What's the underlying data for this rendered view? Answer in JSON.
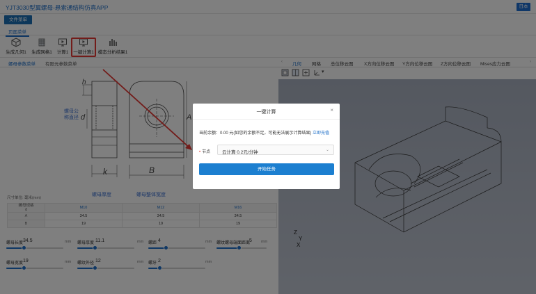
{
  "app": {
    "title": "YJT3030型翼螺母-悬索通结构仿真APP",
    "lang_button": "日本"
  },
  "menu": {
    "file": "文件菜单",
    "page": "页面菜单"
  },
  "toolbar": [
    {
      "label": "生成几何1",
      "icon": "cube-icon"
    },
    {
      "label": "生成网格1",
      "icon": "mesh-icon"
    },
    {
      "label": "计算1",
      "icon": "monitor-icon"
    },
    {
      "label": "一键计算1",
      "icon": "play-monitor-icon"
    },
    {
      "label": "模态分析结果1",
      "icon": "bar-chart-icon"
    }
  ],
  "left_tabs": [
    "螺母参数菜单",
    "有限元参数菜单"
  ],
  "drawing": {
    "labels": {
      "nut_diameter": "螺母公\n称直径",
      "nut_thickness": "螺母厚度",
      "nut_width": "螺母整体宽度",
      "k": "k",
      "B": "B",
      "d": "d",
      "A": "A",
      "h": "h"
    }
  },
  "dims_table": {
    "unit_note": "尺寸单位: 毫米(mm)",
    "corner": "螺母规格\nd",
    "columns": [
      "M10",
      "M12",
      "M16"
    ],
    "rows": [
      {
        "name": "A",
        "values": [
          "34.5",
          "34.5",
          "34.5"
        ]
      },
      {
        "name": "B",
        "values": [
          "19",
          "19",
          "19"
        ]
      }
    ]
  },
  "params": [
    {
      "name": "螺母长度",
      "value": "34.5",
      "unit": "mm",
      "fraction": 0.3
    },
    {
      "name": "螺母厚度",
      "value": "11.1",
      "unit": "mm",
      "fraction": 0.3
    },
    {
      "name": "螺距",
      "value": "4",
      "unit": "mm",
      "fraction": 0.3
    },
    {
      "name": "螺纹螺母端面距离",
      "value": "5",
      "unit": "mm",
      "fraction": 0.45
    },
    {
      "name": "螺母宽度",
      "value": "19",
      "unit": "mm",
      "fraction": 0.3
    },
    {
      "name": "螺纹外径",
      "value": "12",
      "unit": "mm",
      "fraction": 0.3
    },
    {
      "name": "螺牙",
      "value": "2",
      "unit": "mm",
      "fraction": 0.2
    }
  ],
  "right_tabs": [
    "几何",
    "网格",
    "总位移云图",
    "X方向位移云图",
    "Y方向位移云图",
    "Z方向位移云图",
    "Mises应力云图"
  ],
  "axes": {
    "z": "Z",
    "y": "Y",
    "x": "X"
  },
  "dialog": {
    "title": "一键计算",
    "balance_text": "当前余额：0.00 元(如您的余额不足，可能无法展示计算结果)",
    "recharge_link": "立即充值",
    "node_label": "节点",
    "node_value": "云计算 0.2元/分钟",
    "start_button": "开始任务"
  },
  "colors": {
    "accent": "#1e6fc8",
    "highlight": "#e53935",
    "viewport": "#b3bac7"
  }
}
